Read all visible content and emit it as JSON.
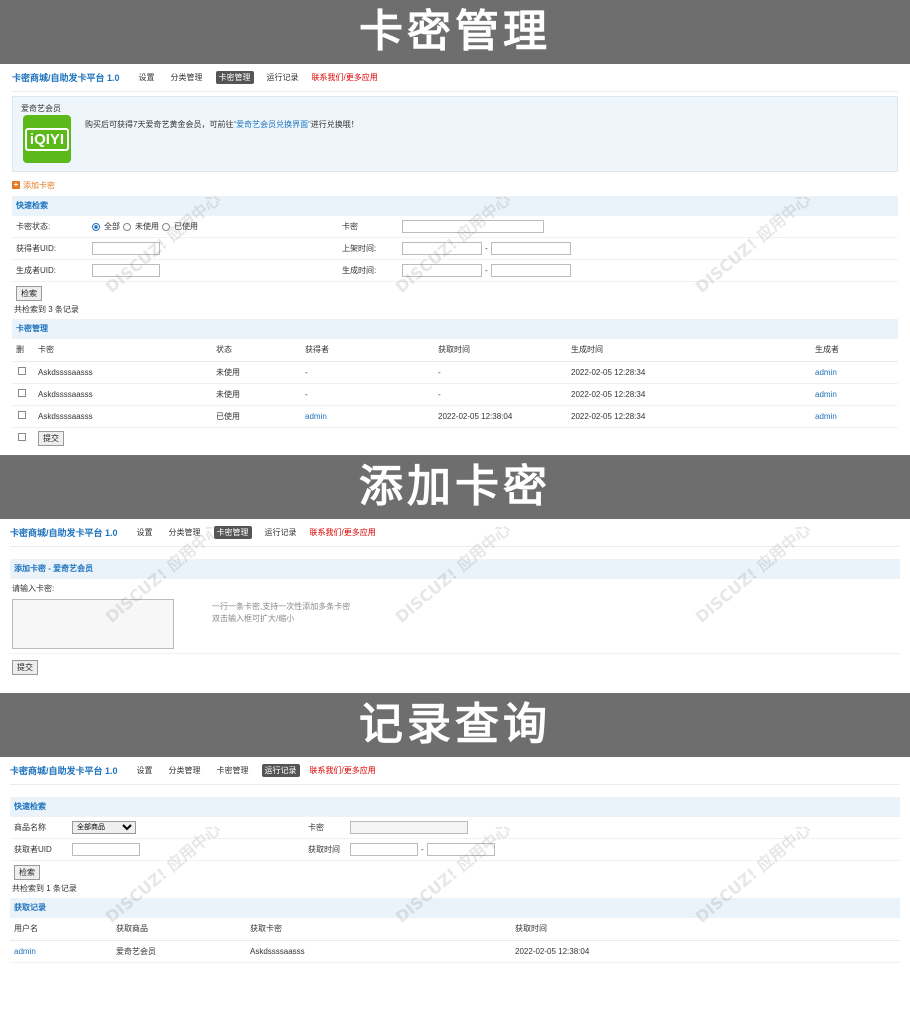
{
  "banners": {
    "card_manage": "卡密管理",
    "add_card": "添加卡密",
    "record_query": "记录查询"
  },
  "nav": {
    "brand": "卡密商城/自助发卡平台 1.0",
    "items": [
      "设置",
      "分类管理",
      "卡密管理",
      "运行记录"
    ],
    "contact": "联系我们/更多应用"
  },
  "product": {
    "name": "爱奇艺会员",
    "logo_text": "iQIYI",
    "desc_before": "购买后可获得7天爱奇艺黄金会员，可前往",
    "desc_link": "“爱奇艺会员兑换界面”",
    "desc_after": "进行兑换哦！"
  },
  "add_card_link": "添加卡密",
  "search": {
    "title": "快速检索",
    "status_label": "卡密状态:",
    "status_options": [
      "全部",
      "未使用",
      "已使用"
    ],
    "card_label": "卡密",
    "getter_uid_label": "获得者UID:",
    "listed_time_label": "上架时间:",
    "creator_uid_label": "生成者UID:",
    "create_time_label": "生成时间:",
    "submit": "检索",
    "count_text": "共检索到 3 条记录",
    "dash": "-"
  },
  "card_table": {
    "title": "卡密管理",
    "headers": [
      "删",
      "卡密",
      "状态",
      "获得者",
      "获取时间",
      "生成时间",
      "生成者"
    ],
    "rows": [
      {
        "card": "Askdssssaasss",
        "status": "未使用",
        "getter": "-",
        "get_time": "-",
        "create_time": "2022-02-05 12:28:34",
        "creator": "admin"
      },
      {
        "card": "Askdssssaasss",
        "status": "未使用",
        "getter": "-",
        "get_time": "-",
        "create_time": "2022-02-05 12:28:34",
        "creator": "admin"
      },
      {
        "card": "Askdssssaasss",
        "status": "已使用",
        "getter": "admin",
        "get_time": "2022-02-05 12:38:04",
        "create_time": "2022-02-05 12:28:34",
        "creator": "admin"
      }
    ],
    "submit": "提交"
  },
  "add_form": {
    "title": "添加卡密 - 爱奇艺会员",
    "input_label": "请输入卡密:",
    "hint1": "一行一条卡密,支持一次性添加多条卡密",
    "hint2": "双击输入框可扩大/缩小",
    "submit": "提交"
  },
  "record_search": {
    "title": "快速检索",
    "product_label": "商品名称",
    "product_selected": "全部商品",
    "card_label": "卡密",
    "getter_uid_label": "获取者UID",
    "get_time_label": "获取时间",
    "submit": "检索",
    "count_text": "共检索到 1 条记录",
    "dash": "-"
  },
  "record_table": {
    "title": "获取记录",
    "headers": [
      "用户名",
      "获取商品",
      "获取卡密",
      "获取时间"
    ],
    "rows": [
      {
        "user": "admin",
        "product": "爱奇艺会员",
        "card": "Askdssssaasss",
        "time": "2022-02-05 12:38:04"
      }
    ]
  },
  "colors": {
    "banner_bg": "#6e6e6e",
    "link_blue": "#1e73be",
    "accent_orange": "#e3781f",
    "contact_red": "#dd0000",
    "logo_green": "#5cb91a"
  }
}
